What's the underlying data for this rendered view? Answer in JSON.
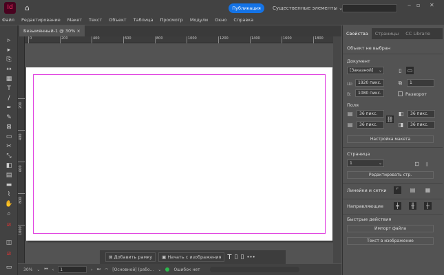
{
  "app": {
    "logo": "Id",
    "publish": "Публикация",
    "workspace": "Существенные элементы",
    "win": [
      "‒",
      "▫",
      "✕"
    ]
  },
  "menu": [
    "Файл",
    "Редактирование",
    "Макет",
    "Текст",
    "Объект",
    "Таблица",
    "Просмотр",
    "Модули",
    "Окно",
    "Справка"
  ],
  "document_tab": {
    "title": "Безымянный-1 @ 30%",
    "close": "×"
  },
  "ruler_h": [
    "0",
    "200",
    "400",
    "600",
    "800",
    "1000",
    "1200",
    "1400",
    "1600",
    "1800"
  ],
  "ruler_v": [
    "200",
    "400",
    "600",
    "800",
    "1000"
  ],
  "context_bar": {
    "add_frame": "Добавить рамку",
    "start_image": "Начать с изображения",
    "more": "•••"
  },
  "status": {
    "zoom": "30%",
    "page": "1",
    "style": "[Основной] (рабо...",
    "errors": "Ошибок нет"
  },
  "panel": {
    "tabs": [
      "Свойства",
      "Страницы",
      "CC Librarie"
    ],
    "no_selection": "Объект не выбран",
    "document_label": "Документ",
    "preset": "[Заказной]",
    "width_label": "Ш:",
    "width": "1920 пикс.",
    "height_label": "В:",
    "height": "1080 пикс.",
    "pages": "1",
    "spread": "Разворот",
    "margins_label": "Поля",
    "margin_top": "36 пикс.",
    "margin_bottom": "36 пикс.",
    "margin_left": "36 пикс.",
    "margin_right": "36 пикс.",
    "layout_btn": "Настройка макета",
    "page_label": "Страница",
    "page_value": "1",
    "edit_page_btn": "Редактировать стр.",
    "rulers_label": "Линейки и сетки",
    "guides_label": "Направляющие",
    "quick_label": "Быстрые действия",
    "import_btn": "Импорт файла",
    "text_to_image_btn": "Текст в изображение"
  }
}
